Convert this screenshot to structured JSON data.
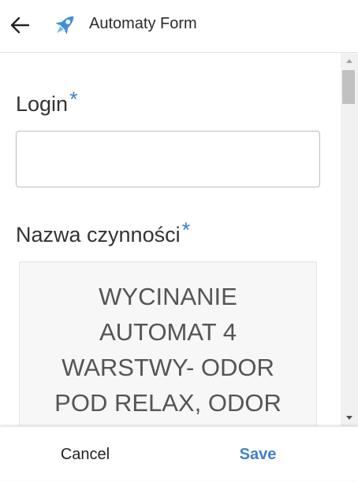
{
  "header": {
    "title": "Automaty Form",
    "back_icon": "arrow-left-icon",
    "app_icon": "rocket-icon",
    "app_icon_color": "#3f8fd8"
  },
  "form": {
    "login": {
      "label": "Login",
      "required_marker": "*",
      "value": "",
      "placeholder": ""
    },
    "action_name": {
      "label": "Nazwa czynności",
      "required_marker": "*",
      "value_lines": [
        "WYCINANIE",
        "AUTOMAT 4",
        "WARSTWY- ODOR",
        "POD RELAX, ODOR"
      ]
    }
  },
  "footer": {
    "cancel_label": "Cancel",
    "save_label": "Save"
  },
  "colors": {
    "accent": "#3f80c7",
    "text": "#333333"
  }
}
